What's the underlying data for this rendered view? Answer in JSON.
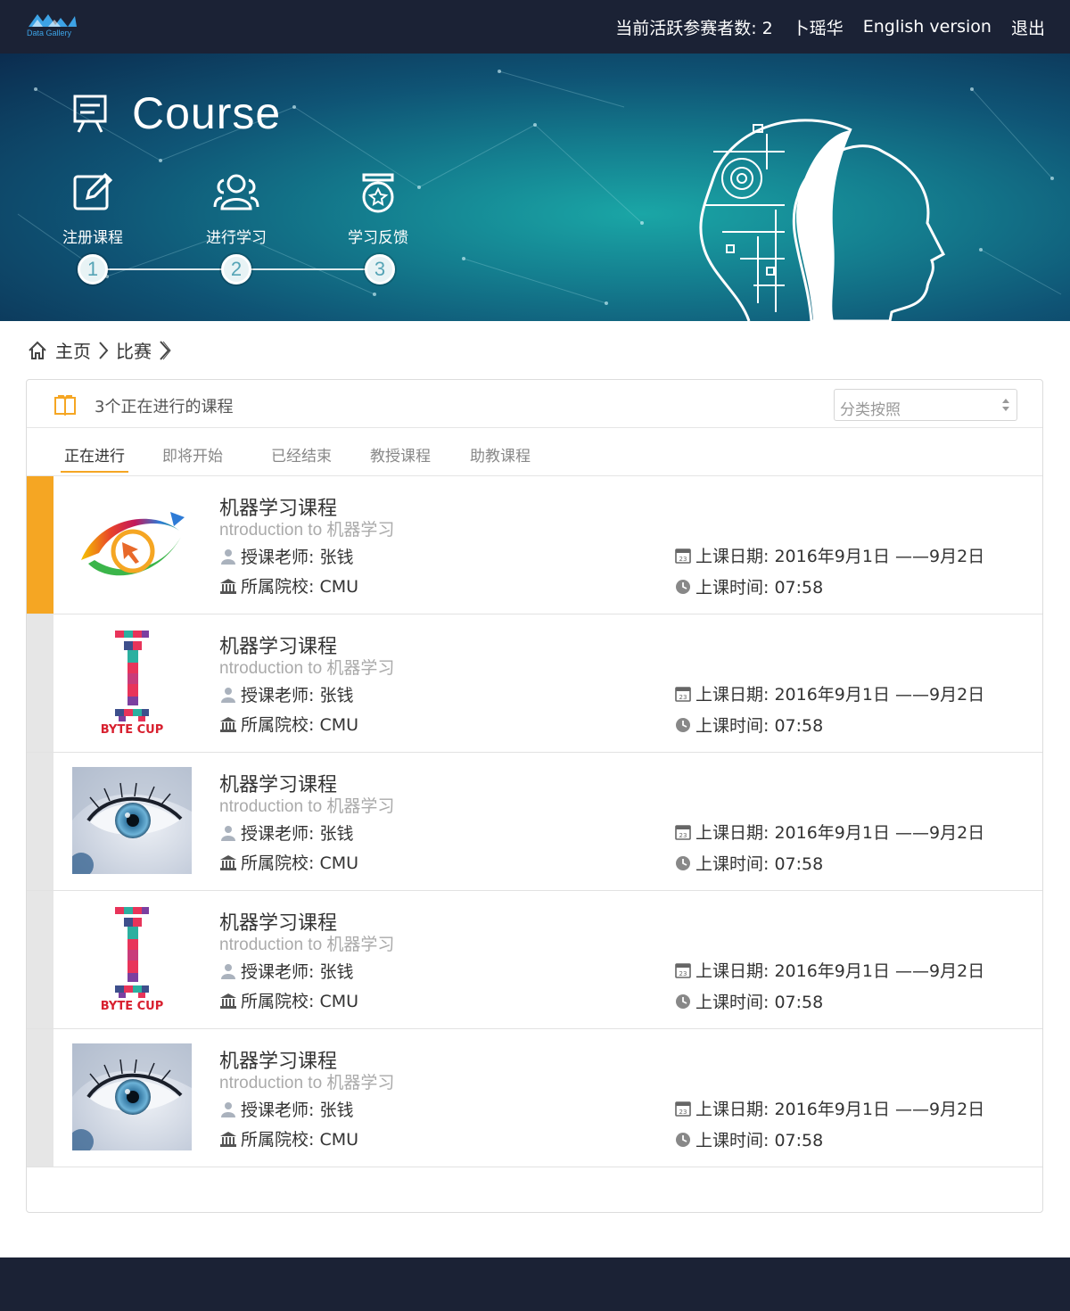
{
  "topbar": {
    "logo_text": "Data Gallery",
    "active_count": "当前活跃参赛者数: 2",
    "user": "卜瑶华",
    "lang": "English version",
    "logout": "退出"
  },
  "hero": {
    "title": "Course",
    "steps": [
      {
        "label": "注册课程",
        "num": "1",
        "icon": "edit-icon"
      },
      {
        "label": "进行学习",
        "num": "2",
        "icon": "users-icon"
      },
      {
        "label": "学习反馈",
        "num": "3",
        "icon": "badge-icon"
      }
    ]
  },
  "breadcrumb": {
    "home": "主页",
    "current": "比赛"
  },
  "panel": {
    "title": "3个正在进行的课程",
    "sort_placeholder": "分类按照",
    "tabs": [
      "正在进行",
      "即将开始",
      "已经结束",
      "教授课程",
      "助教课程"
    ]
  },
  "courses": [
    {
      "name": "机器学习课程",
      "subtitle": "ntroduction to 机器学习",
      "teacher": "授课老师: 张钱",
      "school": "所属院校: CMU",
      "date": "上课日期: 2016年9月1日 ——9月2日",
      "time": "上课时间:  07:58",
      "thumb": "eye-logo"
    },
    {
      "name": "机器学习课程",
      "subtitle": "ntroduction to 机器学习",
      "teacher": "授课老师: 张钱",
      "school": "所属院校: CMU",
      "date": "上课日期: 2016年9月1日 ——9月2日",
      "time": "上课时间:  07:58",
      "thumb": "byte-cup"
    },
    {
      "name": "机器学习课程",
      "subtitle": "ntroduction to 机器学习",
      "teacher": "授课老师: 张钱",
      "school": "所属院校: CMU",
      "date": "上课日期: 2016年9月1日 ——9月2日",
      "time": "上课时间:  07:58",
      "thumb": "eye-photo"
    },
    {
      "name": "机器学习课程",
      "subtitle": "ntroduction to 机器学习",
      "teacher": "授课老师: 张钱",
      "school": "所属院校: CMU",
      "date": "上课日期: 2016年9月1日 ——9月2日",
      "time": "上课时间:  07:58",
      "thumb": "byte-cup"
    },
    {
      "name": "机器学习课程",
      "subtitle": "ntroduction to 机器学习",
      "teacher": "授课老师: 张钱",
      "school": "所属院校: CMU",
      "date": "上课日期: 2016年9月1日 ——9月2日",
      "time": "上课时间:  07:58",
      "thumb": "eye-photo"
    }
  ],
  "byte_cup_text": "BYTE CUP",
  "colors": {
    "nav": "#1b2235",
    "accent": "#f5a623",
    "hero": "#147e8f"
  }
}
